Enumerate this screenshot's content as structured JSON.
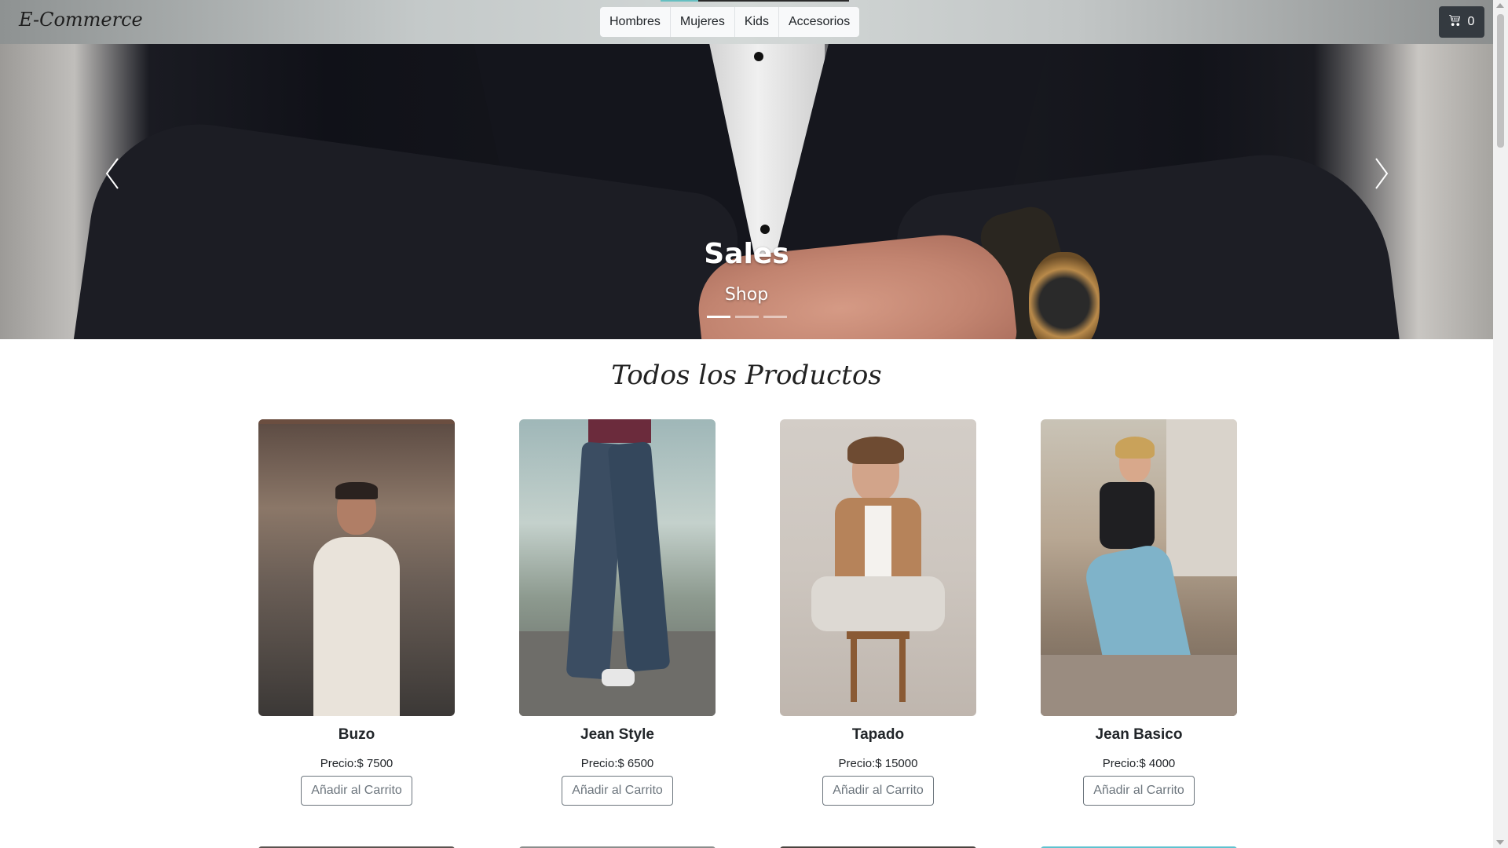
{
  "navbar": {
    "brand": "E-Commerce",
    "links": [
      "Hombres",
      "Mujeres",
      "Kids",
      "Accesorios"
    ],
    "cart": {
      "icon": "cart-icon",
      "count": "0"
    }
  },
  "carousel": {
    "title": "Sales",
    "subtitle": "Shop",
    "indicators": 3,
    "active_index": 0,
    "prev_icon": "chevron-left-icon",
    "next_icon": "chevron-right-icon"
  },
  "products_section": {
    "title": "Todos los Productos",
    "button_label": "Añadir al Carrito",
    "items": [
      {
        "name": "Buzo",
        "price": "Precio:$ 7500"
      },
      {
        "name": "Jean Style",
        "price": "Precio:$ 6500"
      },
      {
        "name": "Tapado",
        "price": "Precio:$ 15000"
      },
      {
        "name": "Jean Basico",
        "price": "Precio:$ 4000"
      }
    ]
  },
  "colors": {
    "cart_button": "#343a40",
    "outline_button": "#6c757d",
    "active_teal": "#66bfc1"
  }
}
